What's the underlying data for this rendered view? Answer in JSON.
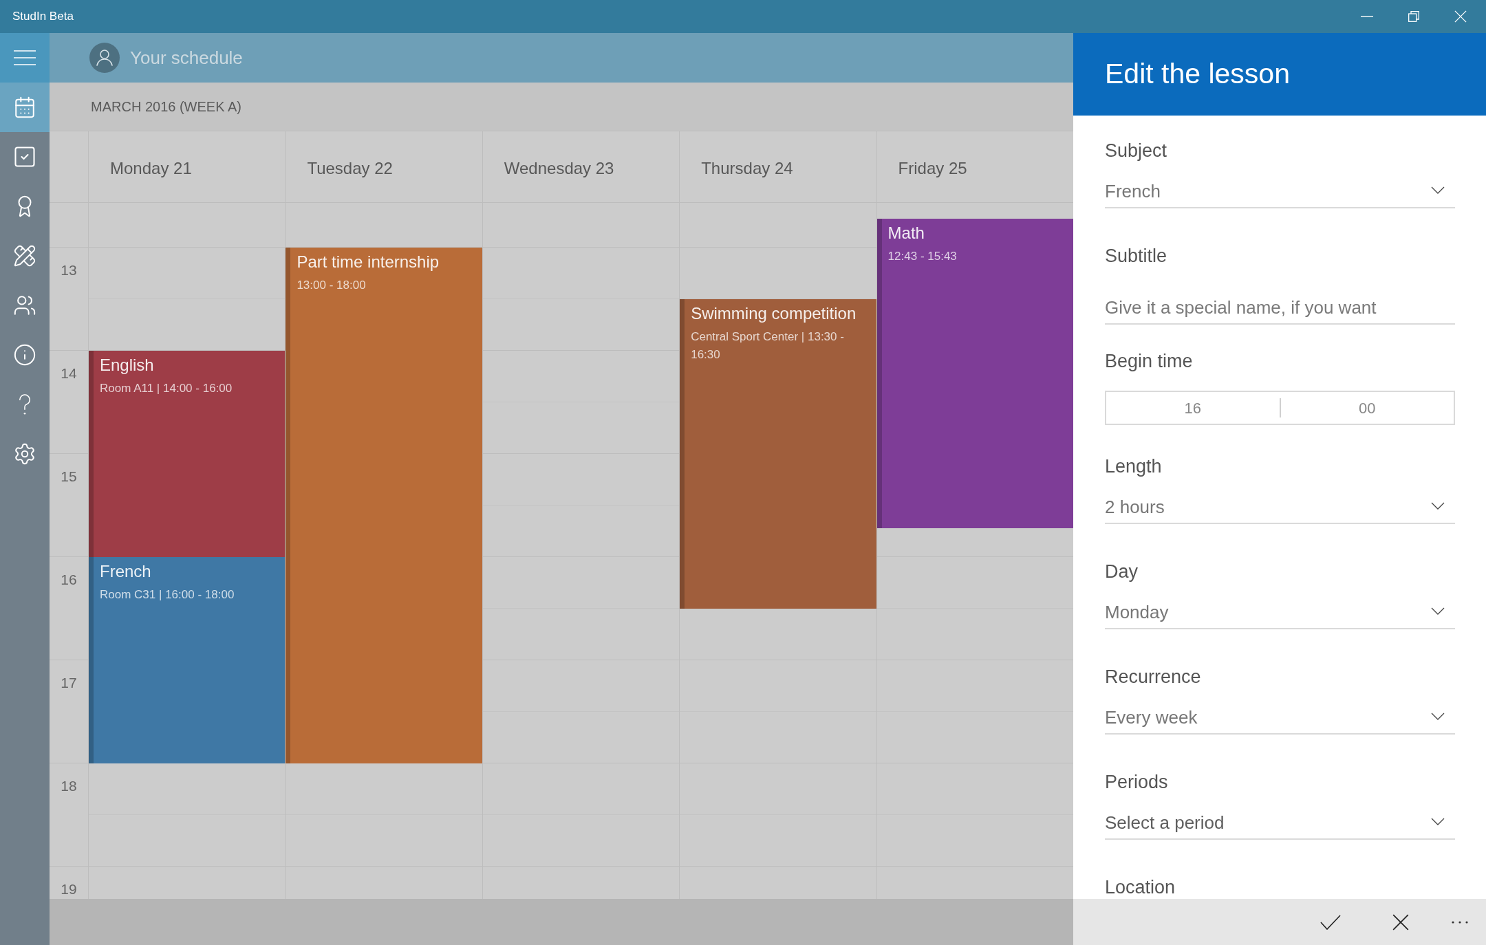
{
  "window": {
    "title": "StudIn Beta"
  },
  "sidebar": {
    "items": [
      {
        "selected": true
      },
      {
        "selected": false
      },
      {
        "selected": false
      },
      {
        "selected": false
      },
      {
        "selected": false
      },
      {
        "selected": false
      },
      {
        "selected": false
      },
      {
        "selected": false
      }
    ]
  },
  "header": {
    "title": "Your schedule"
  },
  "calendar": {
    "period": "MARCH 2016 (WEEK A)",
    "hours": [
      "13",
      "14",
      "15",
      "16",
      "17",
      "18",
      "19"
    ],
    "days": [
      {
        "label": "Monday 21",
        "events": [
          {
            "title": "English",
            "location": "Room A11",
            "separator": "|",
            "start": "14:00",
            "dash": "-",
            "end": "16:00",
            "color": "#9e3d47"
          },
          {
            "title": "French",
            "location": "Room C31",
            "separator": "|",
            "start": "16:00",
            "dash": "-",
            "end": "18:00",
            "color": "#3f78a5"
          }
        ]
      },
      {
        "label": "Tuesday 22",
        "events": [
          {
            "title": "Part time internship",
            "start": "13:00",
            "dash": "-",
            "end": "18:00",
            "color": "#b96c38"
          }
        ]
      },
      {
        "label": "Wednesday 23"
      },
      {
        "label": "Thursday 24",
        "events": [
          {
            "title": "Swimming competition",
            "location": "Central Sport Center",
            "separator": "|",
            "start": "13:30",
            "dash": "-",
            "end": "16:30",
            "color": "#a05e3c"
          }
        ]
      },
      {
        "label": "Friday 25",
        "events": [
          {
            "title": "Math",
            "start": "12:43",
            "dash": "-",
            "end": "15:43",
            "color": "#7e3d97"
          }
        ]
      }
    ]
  },
  "panel": {
    "title": "Edit the lesson",
    "fields": [
      {
        "kind": "dropdown",
        "label": "Subject",
        "value": "French"
      },
      {
        "kind": "text",
        "label": "Subtitle",
        "placeholder": "Give it a special name, if you want"
      },
      {
        "kind": "time",
        "label": "Begin time",
        "hour": "16",
        "minute": "00"
      },
      {
        "kind": "dropdown",
        "label": "Length",
        "value": "2 hours"
      },
      {
        "kind": "dropdown",
        "label": "Day",
        "value": "Monday"
      },
      {
        "kind": "dropdown",
        "label": "Recurrence",
        "value": "Every week"
      },
      {
        "kind": "dropdown",
        "label": "Periods",
        "placeholder": "Select a period"
      },
      {
        "kind": "label",
        "label": "Location"
      }
    ]
  }
}
